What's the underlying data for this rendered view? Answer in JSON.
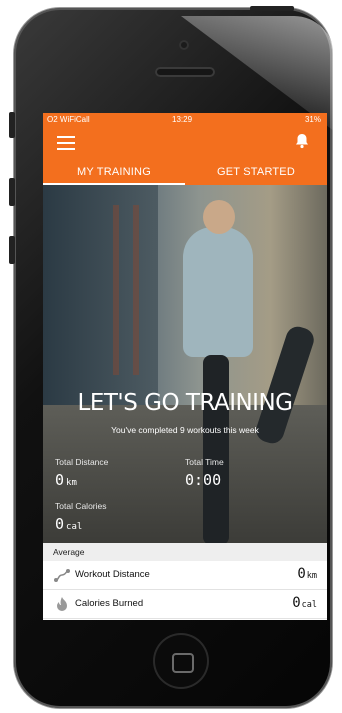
{
  "status_bar": {
    "carrier": "O2 WiFiCall",
    "time": "13:29",
    "battery": "31%"
  },
  "tabs": [
    {
      "label": "MY TRAINING",
      "active": true
    },
    {
      "label": "GET STARTED",
      "active": false
    }
  ],
  "hero": {
    "title": "LET'S GO TRAINING",
    "subtitle": "You've completed 9 workouts this week"
  },
  "stats": {
    "total_distance": {
      "label": "Total Distance",
      "value": "0",
      "unit": "km"
    },
    "total_time": {
      "label": "Total Time",
      "value": "0:00"
    },
    "total_calories": {
      "label": "Total Calories",
      "value": "0",
      "unit": "cal"
    }
  },
  "average": {
    "heading": "Average",
    "rows": [
      {
        "label": "Workout Distance",
        "value": "0",
        "unit": "km",
        "icon": "route-icon"
      },
      {
        "label": "Calories Burned",
        "value": "0",
        "unit": "cal",
        "icon": "flame-icon"
      }
    ]
  },
  "colors": {
    "accent": "#f36f1e"
  },
  "icons": {
    "menu": "menu-icon",
    "notifications": "bell-icon"
  }
}
